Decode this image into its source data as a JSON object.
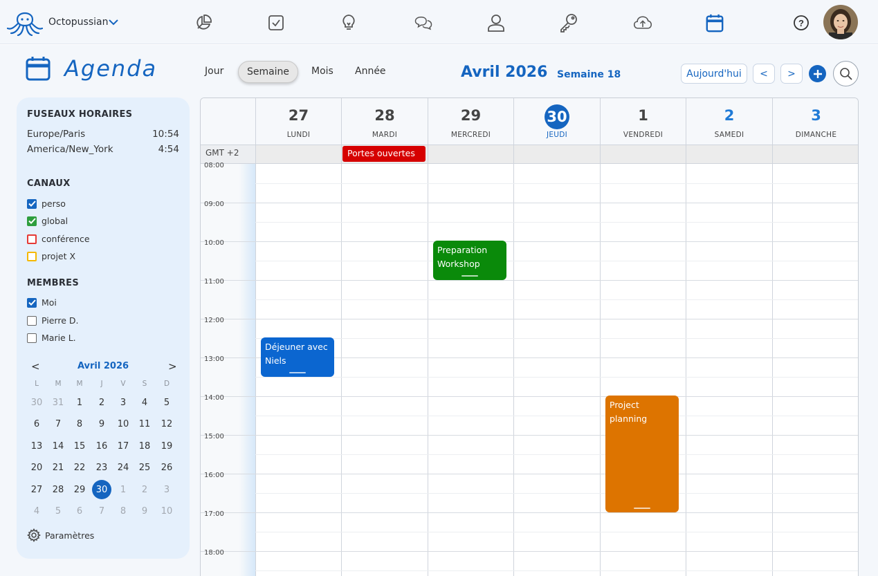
{
  "app": {
    "brand": "Octopussian"
  },
  "nav": [
    {
      "name": "dashboard-icon"
    },
    {
      "name": "tasks-icon"
    },
    {
      "name": "ideas-icon"
    },
    {
      "name": "chat-icon"
    },
    {
      "name": "contacts-icon"
    },
    {
      "name": "keys-icon"
    },
    {
      "name": "cloud-upload-icon"
    },
    {
      "name": "calendar-icon",
      "active": true
    },
    {
      "name": "help-icon"
    }
  ],
  "header": {
    "title": "Agenda",
    "views": [
      "Jour",
      "Semaine",
      "Mois",
      "Année"
    ],
    "active_view": "Semaine",
    "month": "Avril 2026",
    "week": "Semaine 18",
    "today_label": "Aujourd'hui",
    "prev_label": "<",
    "next_label": ">"
  },
  "sidebar": {
    "timezones_title": "FUSEAUX HORAIRES",
    "timezones": [
      {
        "name": "Europe/Paris",
        "time": "10:54"
      },
      {
        "name": "America/New_York",
        "time": "4:54"
      }
    ],
    "channels_title": "CANAUX",
    "channels": [
      {
        "label": "perso",
        "checked": true,
        "color": "#1565c0"
      },
      {
        "label": "global",
        "checked": true,
        "color": "#2e9e3e"
      },
      {
        "label": "conférence",
        "checked": false,
        "color": "#e53935"
      },
      {
        "label": "projet X",
        "checked": false,
        "color": "#f5b800"
      }
    ],
    "members_title": "MEMBRES",
    "members": [
      {
        "label": "Moi",
        "checked": true
      },
      {
        "label": "Pierre D.",
        "checked": false
      },
      {
        "label": "Marie L.",
        "checked": false
      }
    ],
    "mini_calendar": {
      "title": "Avril 2026",
      "prev": "<",
      "next": ">",
      "dow": [
        "L",
        "M",
        "M",
        "J",
        "V",
        "S",
        "D"
      ],
      "weeks": [
        [
          "30",
          "31",
          "1",
          "2",
          "3",
          "4",
          "5"
        ],
        [
          "6",
          "7",
          "8",
          "9",
          "10",
          "11",
          "12"
        ],
        [
          "13",
          "14",
          "15",
          "16",
          "17",
          "18",
          "19"
        ],
        [
          "20",
          "21",
          "22",
          "23",
          "24",
          "25",
          "26"
        ],
        [
          "27",
          "28",
          "29",
          "30",
          "1",
          "2",
          "3"
        ],
        [
          "4",
          "5",
          "6",
          "7",
          "8",
          "9",
          "10"
        ]
      ],
      "selected": "30"
    },
    "settings_label": "Paramètres"
  },
  "week": {
    "gmt_label": "GMT +2",
    "days": [
      {
        "num": "27",
        "name": "LUNDI"
      },
      {
        "num": "28",
        "name": "MARDI"
      },
      {
        "num": "29",
        "name": "MERCREDI"
      },
      {
        "num": "30",
        "name": "JEUDI",
        "today": true
      },
      {
        "num": "1",
        "name": "VENDREDI"
      },
      {
        "num": "2",
        "name": "SAMEDI",
        "weekend": true
      },
      {
        "num": "3",
        "name": "DIMANCHE",
        "weekend": true
      }
    ],
    "hours": [
      "08:00",
      "09:00",
      "10:00",
      "11:00",
      "12:00",
      "13:00",
      "14:00",
      "15:00",
      "16:00",
      "17:00",
      "18:00"
    ],
    "allday_events": [
      {
        "title": "Portes ouvertes",
        "day": 1,
        "color": "#d60000"
      }
    ],
    "events": [
      {
        "title": "Preparation Workshop",
        "day": 2,
        "start": "10:00",
        "end": "11:00",
        "color": "#0a8a0a"
      },
      {
        "title": "Déjeuner avec Niels",
        "day": 0,
        "start": "12:30",
        "end": "13:30",
        "color": "#0b66d0"
      },
      {
        "title": "Project planning",
        "day": 4,
        "start": "14:00",
        "end": "17:00",
        "color": "#dd7400"
      }
    ]
  },
  "colors": {
    "accent": "#1565c0",
    "today": "#1565c0",
    "weekend_num": "#1f7ad6"
  }
}
